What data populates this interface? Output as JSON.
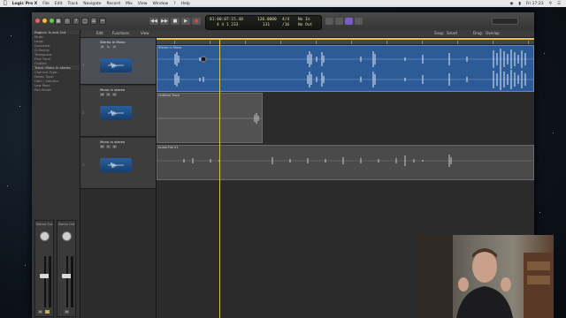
{
  "menubar": {
    "apple": "",
    "app_name": "Logic Pro X",
    "items": [
      "File",
      "Edit",
      "Track",
      "Navigate",
      "Record",
      "Mix",
      "View",
      "Window",
      "?",
      "Help"
    ],
    "clock": "Fri 17:23"
  },
  "window": {
    "title": "Untitled - Tracks"
  },
  "lcd": {
    "time": "01:00:07:15.48",
    "bars": "4  4  1  233",
    "tempo": "120.0000",
    "tempo_label": "131",
    "signature": "4/4",
    "signature_sub": "/16",
    "input": "No In",
    "output": "No Out"
  },
  "toolbar": {
    "region_label": "Region: In and Out",
    "edit": "Edit",
    "functions": "Functions",
    "view": "View",
    "snap_label": "Snap:",
    "snap_value": "Smart",
    "drag_label": "Drag:",
    "drag_value": "Overlap"
  },
  "inspector": {
    "rows": [
      "Region: In and Out",
      "Mute:",
      "Loop:",
      "Quantize:",
      "Q-Swing:",
      "Transpose:",
      "Fine Tune:",
      "Flatten:",
      "Track: Mono in stereo",
      "Channel Type:",
      "Fades Type:",
      "Gain / Volume:",
      "Low Pass:",
      "Pan Mode:"
    ],
    "channels": [
      {
        "name": "Stereo Out",
        "bottom": "Mono in stereo"
      },
      {
        "name": "Stereo Out",
        "bottom": "Stereo Out"
      }
    ]
  },
  "tracks": [
    {
      "num": "1",
      "name": "Stereo in Mono",
      "selected": true,
      "region": "Stereo in Mono"
    },
    {
      "num": "2",
      "name": "Mono in stereo",
      "selected": false,
      "region": "Untitled Track"
    },
    {
      "num": "3",
      "name": "Mono in stereo",
      "selected": false,
      "region": "Audio File 01"
    }
  ],
  "colors": {
    "region_blue": "#2c5b98",
    "region_grey": "#525252",
    "cycle_yellow": "#e3c64a",
    "playhead": "#d8c34f"
  }
}
